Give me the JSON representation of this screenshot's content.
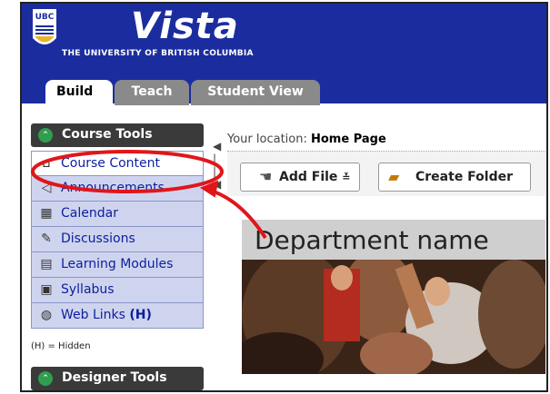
{
  "header": {
    "logo_text": "UBC",
    "title": "Vista",
    "university": "THE UNIVERSITY OF  BRITISH COLUMBIA",
    "brand_color": "#1b2d9e"
  },
  "tabs": [
    {
      "label": "Build",
      "active": true
    },
    {
      "label": "Teach",
      "active": false
    },
    {
      "label": "Student View",
      "active": false
    }
  ],
  "sidebar": {
    "course_tools_label": "Course Tools",
    "items": [
      {
        "label": "Course Content",
        "icon": "home-icon"
      },
      {
        "label": "Announcements",
        "icon": "megaphone-icon"
      },
      {
        "label": "Calendar",
        "icon": "calendar-icon"
      },
      {
        "label": "Discussions",
        "icon": "pin-icon"
      },
      {
        "label": "Learning Modules",
        "icon": "document-icon"
      },
      {
        "label": "Syllabus",
        "icon": "syllabus-icon"
      },
      {
        "label": "Web Links",
        "suffix": "(H)",
        "icon": "globe-icon"
      }
    ],
    "hidden_note": "(H) = Hidden",
    "designer_tools_label": "Designer Tools"
  },
  "location": {
    "prefix": "Your location:",
    "page": "Home Page"
  },
  "toolbar": {
    "add_file": "Add File",
    "create_folder": "Create Folder"
  },
  "banner": {
    "title": "Department name"
  },
  "annotation_color": "#e0161b"
}
